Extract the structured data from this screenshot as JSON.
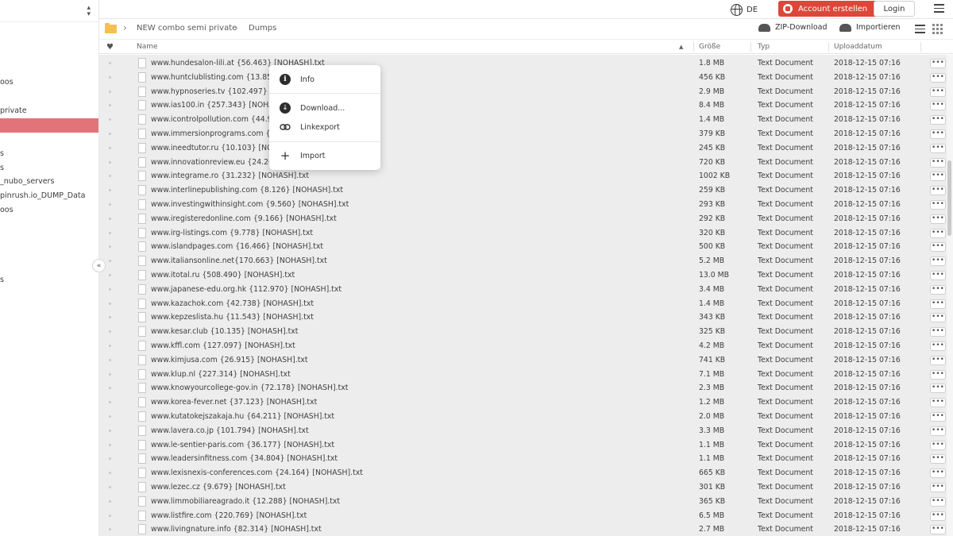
{
  "sidebar": {
    "items": [
      {
        "label": "oos",
        "active": false
      },
      {
        "label": "private",
        "active": false
      },
      {
        "label": "",
        "active": true
      },
      {
        "label": "s",
        "active": false
      },
      {
        "label": "s",
        "active": false
      },
      {
        "label": "_nubo_servers",
        "active": false
      },
      {
        "label": "pinrush.io_DUMP_Data",
        "active": false
      },
      {
        "label": "oos",
        "active": false
      },
      {
        "label": "s",
        "active": false
      }
    ],
    "sort_icon": "sort-updown-icon",
    "collapse_icon": "«"
  },
  "topbar": {
    "language": "DE",
    "create_account": "Account erstellen",
    "login": "Login"
  },
  "breadcrumb": {
    "items": [
      "NEW combo semi private",
      "Dumps"
    ],
    "zip_download": "ZIP-Download",
    "import": "Importieren"
  },
  "table": {
    "headers": {
      "name": "Name",
      "size": "Größe",
      "type": "Typ",
      "upload": "Uploaddatum"
    },
    "rows": [
      {
        "name": "www.hundesalon-lili.at {56.463} [NOHASH].txt",
        "size": "1.8 MB",
        "type": "Text Document",
        "date": "2018-12-15 07:16"
      },
      {
        "name": "www.huntclublisting.com {13.857} [NOHASH].txt",
        "size": "456 KB",
        "type": "Text Document",
        "date": "2018-12-15 07:16"
      },
      {
        "name": "www.hypnoseries.tv {102.497} [NOHASH].txt",
        "size": "2.9 MB",
        "type": "Text Document",
        "date": "2018-12-15 07:16"
      },
      {
        "name": "www.ias100.in {257.343} [NOHASH].txt",
        "size": "8.4 MB",
        "type": "Text Document",
        "date": "2018-12-15 07:16"
      },
      {
        "name": "www.icontrolpollution.com {44.94",
        "size": "1.4 MB",
        "type": "Text Document",
        "date": "2018-12-15 07:16"
      },
      {
        "name": "www.immersionprograms.com {11",
        "size": "379 KB",
        "type": "Text Document",
        "date": "2018-12-15 07:16"
      },
      {
        "name": "www.ineedtutor.ru {10.103} [NOH",
        "size": "245 KB",
        "type": "Text Document",
        "date": "2018-12-15 07:16"
      },
      {
        "name": "www.innovationreview.eu {24.269}",
        "size": "720 KB",
        "type": "Text Document",
        "date": "2018-12-15 07:16"
      },
      {
        "name": "www.integrame.ro {31.232} [NOHASH].txt",
        "size": "1002 KB",
        "type": "Text Document",
        "date": "2018-12-15 07:16"
      },
      {
        "name": "www.interlinepublishing.com {8.126} [NOHASH].txt",
        "size": "259 KB",
        "type": "Text Document",
        "date": "2018-12-15 07:16"
      },
      {
        "name": "www.investingwithinsight.com {9.560} [NOHASH].txt",
        "size": "293 KB",
        "type": "Text Document",
        "date": "2018-12-15 07:16"
      },
      {
        "name": "www.iregisteredonline.com {9.166} [NOHASH].txt",
        "size": "292 KB",
        "type": "Text Document",
        "date": "2018-12-15 07:16"
      },
      {
        "name": "www.irg-listings.com {9.778} [NOHASH].txt",
        "size": "320 KB",
        "type": "Text Document",
        "date": "2018-12-15 07:16"
      },
      {
        "name": "www.islandpages.com {16.466} [NOHASH].txt",
        "size": "500 KB",
        "type": "Text Document",
        "date": "2018-12-15 07:16"
      },
      {
        "name": "www.italiansonline.net{170.663} [NOHASH].txt",
        "size": "5.2 MB",
        "type": "Text Document",
        "date": "2018-12-15 07:16"
      },
      {
        "name": "www.itotal.ru {508.490} [NOHASH].txt",
        "size": "13.0 MB",
        "type": "Text Document",
        "date": "2018-12-15 07:16"
      },
      {
        "name": "www.japanese-edu.org.hk {112.970} [NOHASH].txt",
        "size": "3.4 MB",
        "type": "Text Document",
        "date": "2018-12-15 07:16"
      },
      {
        "name": "www.kazachok.com {42.738} [NOHASH].txt",
        "size": "1.4 MB",
        "type": "Text Document",
        "date": "2018-12-15 07:16"
      },
      {
        "name": "www.kepzeslista.hu {11.543} [NOHASH].txt",
        "size": "343 KB",
        "type": "Text Document",
        "date": "2018-12-15 07:16"
      },
      {
        "name": "www.kesar.club {10.135} [NOHASH].txt",
        "size": "325 KB",
        "type": "Text Document",
        "date": "2018-12-15 07:16"
      },
      {
        "name": "www.kffl.com {127.097} [NOHASH].txt",
        "size": "4.2 MB",
        "type": "Text Document",
        "date": "2018-12-15 07:16"
      },
      {
        "name": "www.kimjusa.com {26.915} [NOHASH].txt",
        "size": "741 KB",
        "type": "Text Document",
        "date": "2018-12-15 07:16"
      },
      {
        "name": "www.klup.nl {227.314} [NOHASH].txt",
        "size": "7.1 MB",
        "type": "Text Document",
        "date": "2018-12-15 07:16"
      },
      {
        "name": "www.knowyourcollege-gov.in {72.178} [NOHASH].txt",
        "size": "2.3 MB",
        "type": "Text Document",
        "date": "2018-12-15 07:16"
      },
      {
        "name": "www.korea-fever.net {37.123} [NOHASH].txt",
        "size": "1.2 MB",
        "type": "Text Document",
        "date": "2018-12-15 07:16"
      },
      {
        "name": "www.kutatokejszakaja.hu {64.211} [NOHASH].txt",
        "size": "2.0 MB",
        "type": "Text Document",
        "date": "2018-12-15 07:16"
      },
      {
        "name": "www.lavera.co.jp {101.794} [NOHASH].txt",
        "size": "3.3 MB",
        "type": "Text Document",
        "date": "2018-12-15 07:16"
      },
      {
        "name": "www.le-sentier-paris.com {36.177} [NOHASH].txt",
        "size": "1.1 MB",
        "type": "Text Document",
        "date": "2018-12-15 07:16"
      },
      {
        "name": "www.leadersinfitness.com {34.804} [NOHASH].txt",
        "size": "1.1 MB",
        "type": "Text Document",
        "date": "2018-12-15 07:16"
      },
      {
        "name": "www.lexisnexis-conferences.com {24.164} [NOHASH].txt",
        "size": "665 KB",
        "type": "Text Document",
        "date": "2018-12-15 07:16"
      },
      {
        "name": "www.lezec.cz {9.679} [NOHASH].txt",
        "size": "301 KB",
        "type": "Text Document",
        "date": "2018-12-15 07:16"
      },
      {
        "name": "www.limmobiliareagrado.it {12.288} [NOHASH].txt",
        "size": "365 KB",
        "type": "Text Document",
        "date": "2018-12-15 07:16"
      },
      {
        "name": "www.listfire.com {220.769} [NOHASH].txt",
        "size": "6.5 MB",
        "type": "Text Document",
        "date": "2018-12-15 07:16"
      },
      {
        "name": "www.livingnature.info {82.314} [NOHASH].txt",
        "size": "2.7 MB",
        "type": "Text Document",
        "date": "2018-12-15 07:16"
      }
    ]
  },
  "context_menu": {
    "items": [
      {
        "label": "Info",
        "icon": "info-icon"
      },
      {
        "label": "Download...",
        "icon": "download-icon"
      },
      {
        "label": "Linkexport",
        "icon": "link-icon"
      },
      {
        "label": "Import",
        "icon": "plus-icon"
      }
    ]
  },
  "colors": {
    "accent_red": "#dc473a",
    "sidebar_active": "#e27479",
    "table_bg": "#ededed"
  }
}
